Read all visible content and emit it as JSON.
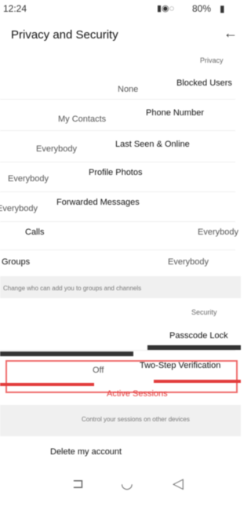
{
  "status_bar": {
    "time": "12:24",
    "battery": "80%"
  },
  "header": {
    "title": "Privacy and Security"
  },
  "sections": {
    "privacy_header": "Privacy",
    "security_header": "Security"
  },
  "rows": {
    "blocked_users": {
      "label": "Blocked Users",
      "value": "None"
    },
    "phone_number": {
      "label": "Phone Number",
      "value": "My Contacts"
    },
    "last_seen": {
      "label": "Last Seen & Online",
      "value": "Everybody"
    },
    "profile_photos": {
      "label": "Profile Photos",
      "value": "Everybody"
    },
    "forwarded_messages": {
      "label": "Forwarded Messages",
      "value": "Everybody"
    },
    "calls": {
      "label": "Calls",
      "value": "Everybody"
    },
    "groups": {
      "label": "Groups",
      "value": "Everybody"
    },
    "groups_hint": "Change who can add you to groups and channels",
    "passcode_lock": {
      "label": "Passcode Lock"
    },
    "two_step": {
      "label": "Two-Step Verification",
      "value": "Off"
    },
    "active_sessions": {
      "label": "Active Sessions"
    },
    "sessions_hint": "Control your sessions on other devices",
    "delete_account": {
      "label": "Delete my account"
    }
  },
  "icons": {
    "back": "arrow-left-icon",
    "nav_recent": "recent-apps-icon",
    "nav_home": "home-icon",
    "nav_back": "nav-back-icon"
  },
  "colors": {
    "highlight": "#e23b3b"
  }
}
